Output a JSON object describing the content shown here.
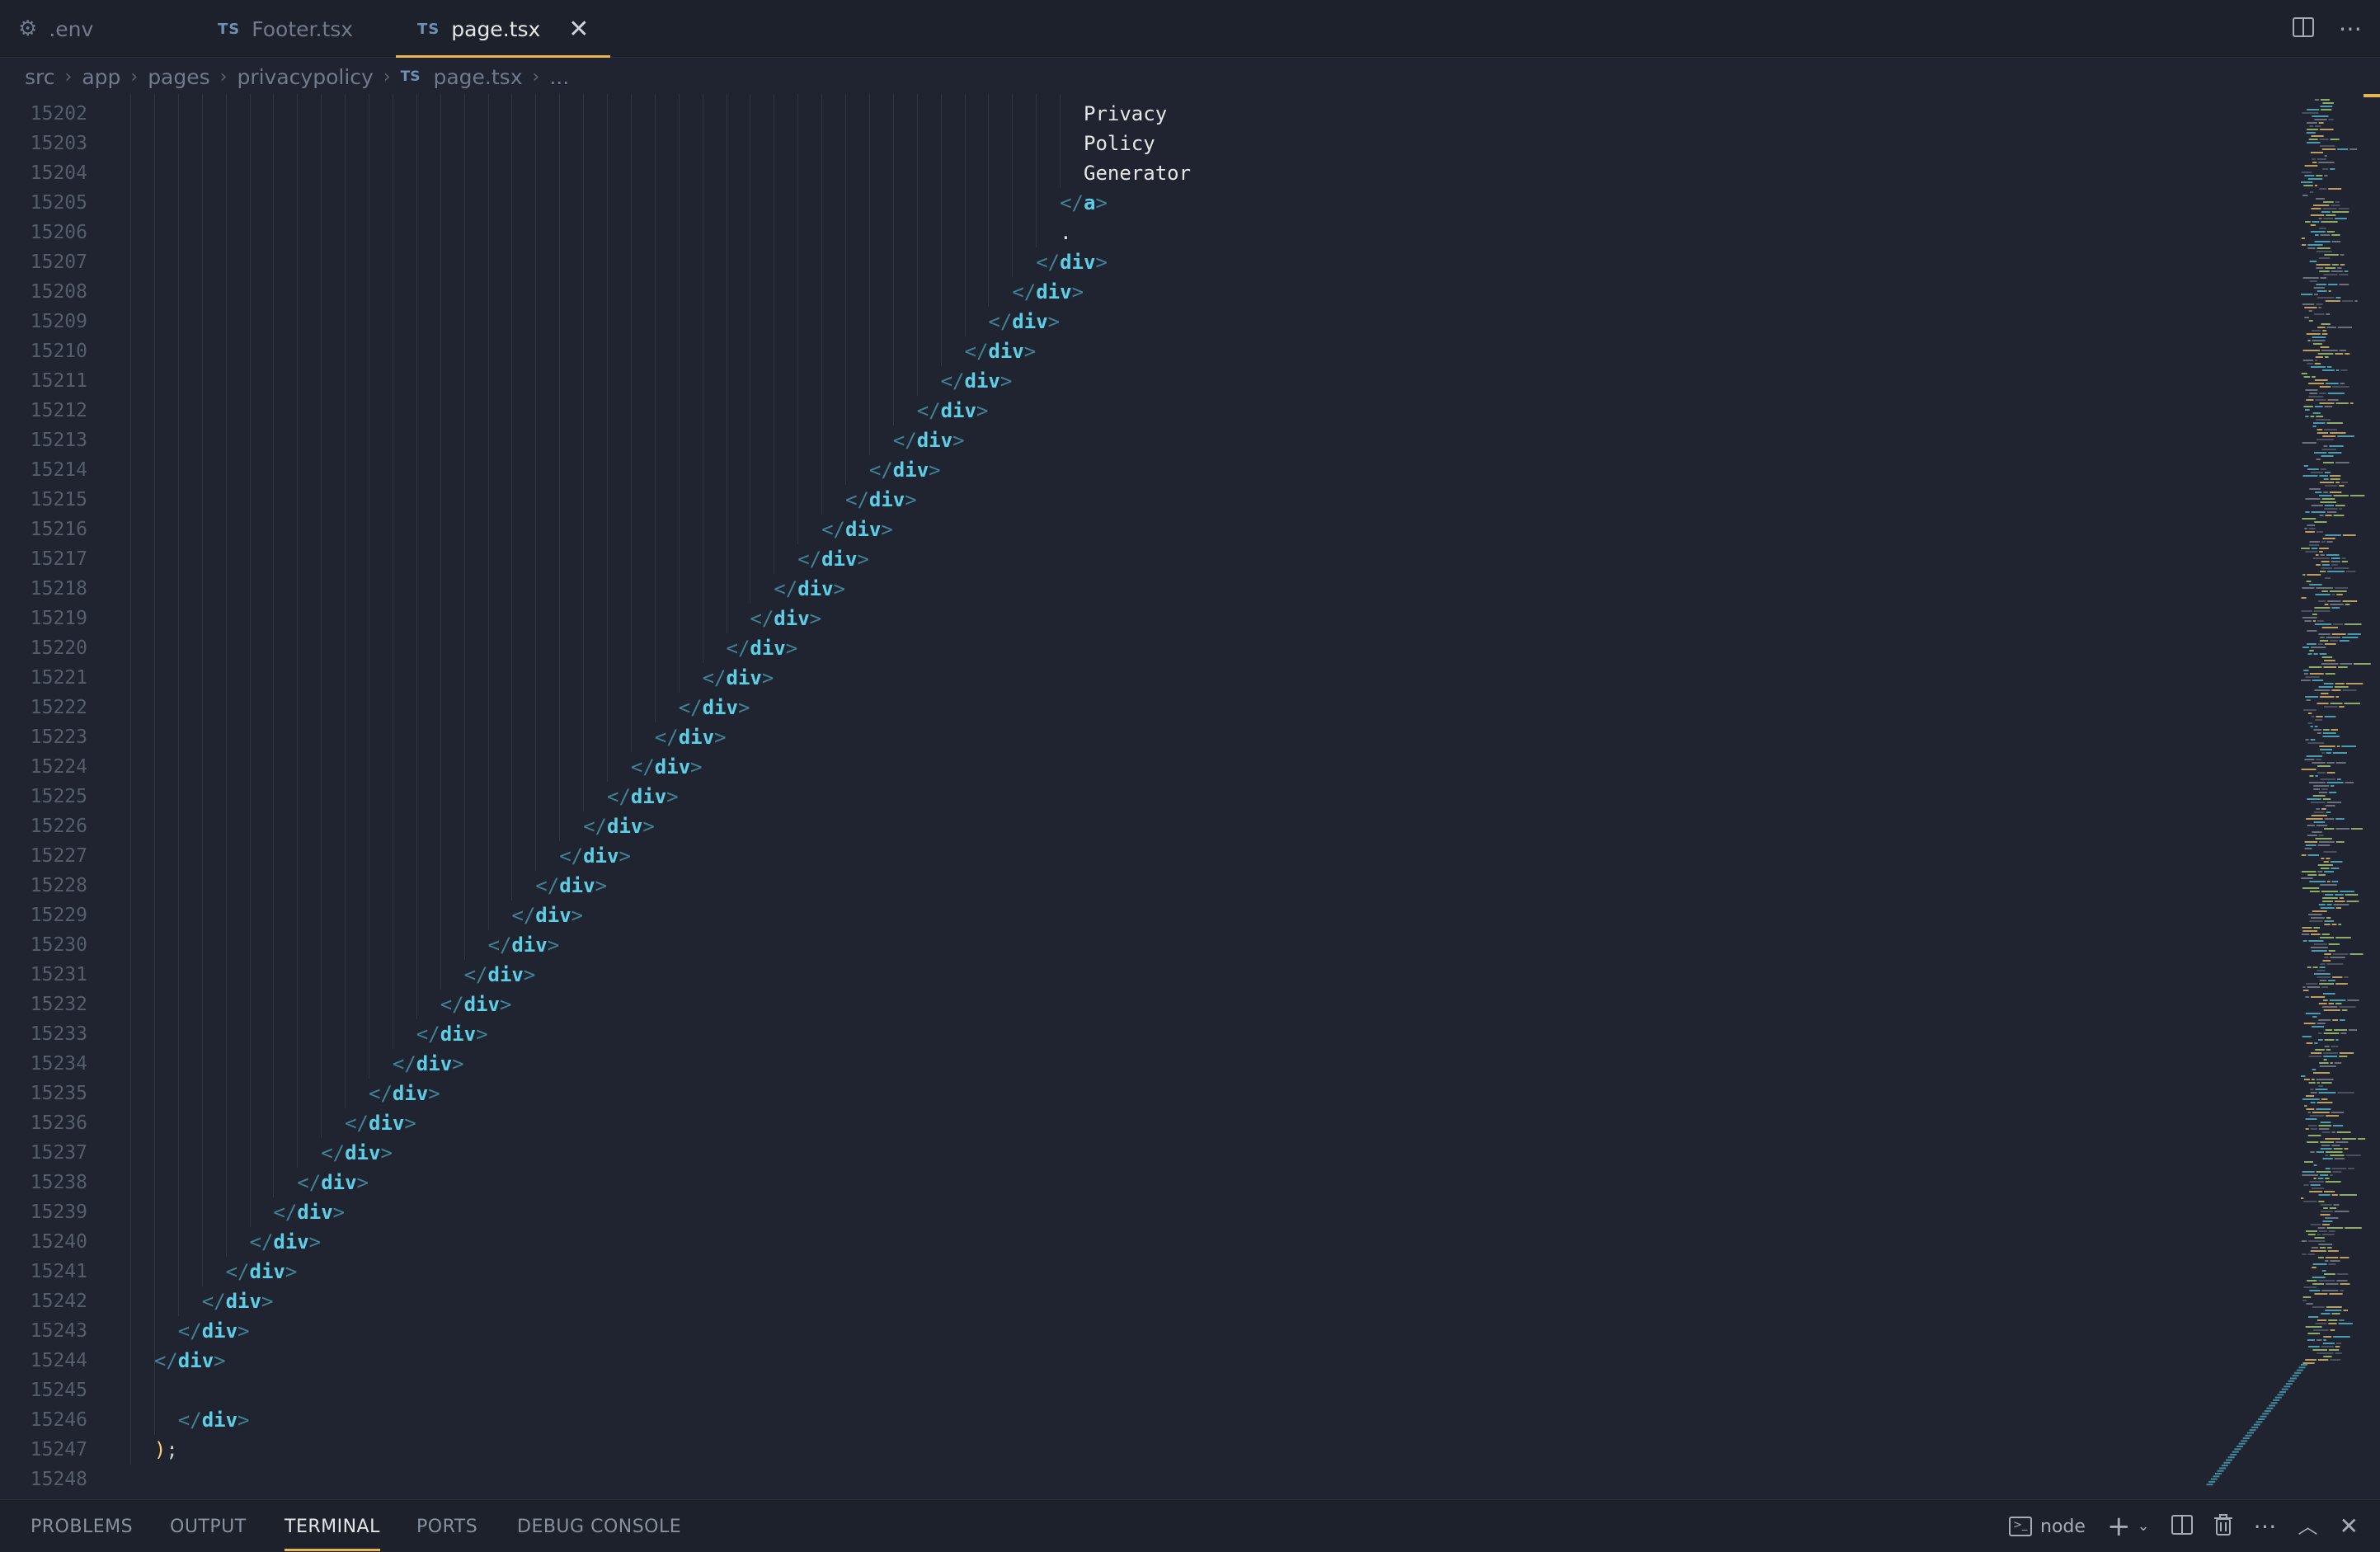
{
  "tabs": [
    {
      "label": ".env",
      "icon": "gear-icon",
      "active": false
    },
    {
      "label": "Footer.tsx",
      "icon": "typescript-icon",
      "icon_text": "TS",
      "active": false
    },
    {
      "label": "page.tsx",
      "icon": "typescript-icon",
      "icon_text": "TS",
      "active": true
    }
  ],
  "breadcrumb": {
    "items": [
      "src",
      "app",
      "pages",
      "privacypolicy"
    ],
    "file_icon_text": "TS",
    "file": "page.tsx",
    "more": "..."
  },
  "editor": {
    "lines": [
      {
        "num": "15202",
        "indent": 40,
        "kind": "text",
        "text": "Privacy"
      },
      {
        "num": "15203",
        "indent": 40,
        "kind": "text",
        "text": "Policy"
      },
      {
        "num": "15204",
        "indent": 40,
        "kind": "text",
        "text": "Generator"
      },
      {
        "num": "15205",
        "indent": 39,
        "kind": "close",
        "tag": "a"
      },
      {
        "num": "15206",
        "indent": 39,
        "kind": "text",
        "text": "."
      },
      {
        "num": "15207",
        "indent": 38,
        "kind": "close",
        "tag": "div"
      },
      {
        "num": "15208",
        "indent": 37,
        "kind": "close",
        "tag": "div"
      },
      {
        "num": "15209",
        "indent": 36,
        "kind": "close",
        "tag": "div"
      },
      {
        "num": "15210",
        "indent": 35,
        "kind": "close",
        "tag": "div"
      },
      {
        "num": "15211",
        "indent": 34,
        "kind": "close",
        "tag": "div"
      },
      {
        "num": "15212",
        "indent": 33,
        "kind": "close",
        "tag": "div"
      },
      {
        "num": "15213",
        "indent": 32,
        "kind": "close",
        "tag": "div"
      },
      {
        "num": "15214",
        "indent": 31,
        "kind": "close",
        "tag": "div"
      },
      {
        "num": "15215",
        "indent": 30,
        "kind": "close",
        "tag": "div"
      },
      {
        "num": "15216",
        "indent": 29,
        "kind": "close",
        "tag": "div"
      },
      {
        "num": "15217",
        "indent": 28,
        "kind": "close",
        "tag": "div"
      },
      {
        "num": "15218",
        "indent": 27,
        "kind": "close",
        "tag": "div"
      },
      {
        "num": "15219",
        "indent": 26,
        "kind": "close",
        "tag": "div"
      },
      {
        "num": "15220",
        "indent": 25,
        "kind": "close",
        "tag": "div"
      },
      {
        "num": "15221",
        "indent": 24,
        "kind": "close",
        "tag": "div"
      },
      {
        "num": "15222",
        "indent": 23,
        "kind": "close",
        "tag": "div"
      },
      {
        "num": "15223",
        "indent": 22,
        "kind": "close",
        "tag": "div"
      },
      {
        "num": "15224",
        "indent": 21,
        "kind": "close",
        "tag": "div"
      },
      {
        "num": "15225",
        "indent": 20,
        "kind": "close",
        "tag": "div"
      },
      {
        "num": "15226",
        "indent": 19,
        "kind": "close",
        "tag": "div"
      },
      {
        "num": "15227",
        "indent": 18,
        "kind": "close",
        "tag": "div"
      },
      {
        "num": "15228",
        "indent": 17,
        "kind": "close",
        "tag": "div"
      },
      {
        "num": "15229",
        "indent": 16,
        "kind": "close",
        "tag": "div"
      },
      {
        "num": "15230",
        "indent": 15,
        "kind": "close",
        "tag": "div"
      },
      {
        "num": "15231",
        "indent": 14,
        "kind": "close",
        "tag": "div"
      },
      {
        "num": "15232",
        "indent": 13,
        "kind": "close",
        "tag": "div"
      },
      {
        "num": "15233",
        "indent": 12,
        "kind": "close",
        "tag": "div"
      },
      {
        "num": "15234",
        "indent": 11,
        "kind": "close",
        "tag": "div"
      },
      {
        "num": "15235",
        "indent": 10,
        "kind": "close",
        "tag": "div"
      },
      {
        "num": "15236",
        "indent": 9,
        "kind": "close",
        "tag": "div"
      },
      {
        "num": "15237",
        "indent": 8,
        "kind": "close",
        "tag": "div"
      },
      {
        "num": "15238",
        "indent": 7,
        "kind": "close",
        "tag": "div"
      },
      {
        "num": "15239",
        "indent": 6,
        "kind": "close",
        "tag": "div"
      },
      {
        "num": "15240",
        "indent": 5,
        "kind": "close",
        "tag": "div"
      },
      {
        "num": "15241",
        "indent": 4,
        "kind": "close",
        "tag": "div"
      },
      {
        "num": "15242",
        "indent": 3,
        "kind": "close",
        "tag": "div"
      },
      {
        "num": "15243",
        "indent": 2,
        "kind": "close",
        "tag": "div"
      },
      {
        "num": "15244",
        "indent": 1,
        "kind": "close",
        "tag": "div"
      },
      {
        "num": "15245",
        "indent": 0,
        "kind": "blank"
      },
      {
        "num": "15246",
        "indent": 2,
        "kind": "close",
        "tag": "div"
      },
      {
        "num": "15247",
        "indent": 1,
        "kind": "paren",
        "text": ");"
      },
      {
        "num": "15248",
        "indent": 0,
        "kind": "blank"
      }
    ]
  },
  "panel": {
    "tabs": [
      "PROBLEMS",
      "OUTPUT",
      "TERMINAL",
      "PORTS",
      "DEBUG CONSOLE"
    ],
    "active_tab": "TERMINAL",
    "terminal_name": "node"
  },
  "colors": {
    "accent": "#e6b450",
    "tag": "#5ccfe6",
    "background": "#1f2430"
  }
}
